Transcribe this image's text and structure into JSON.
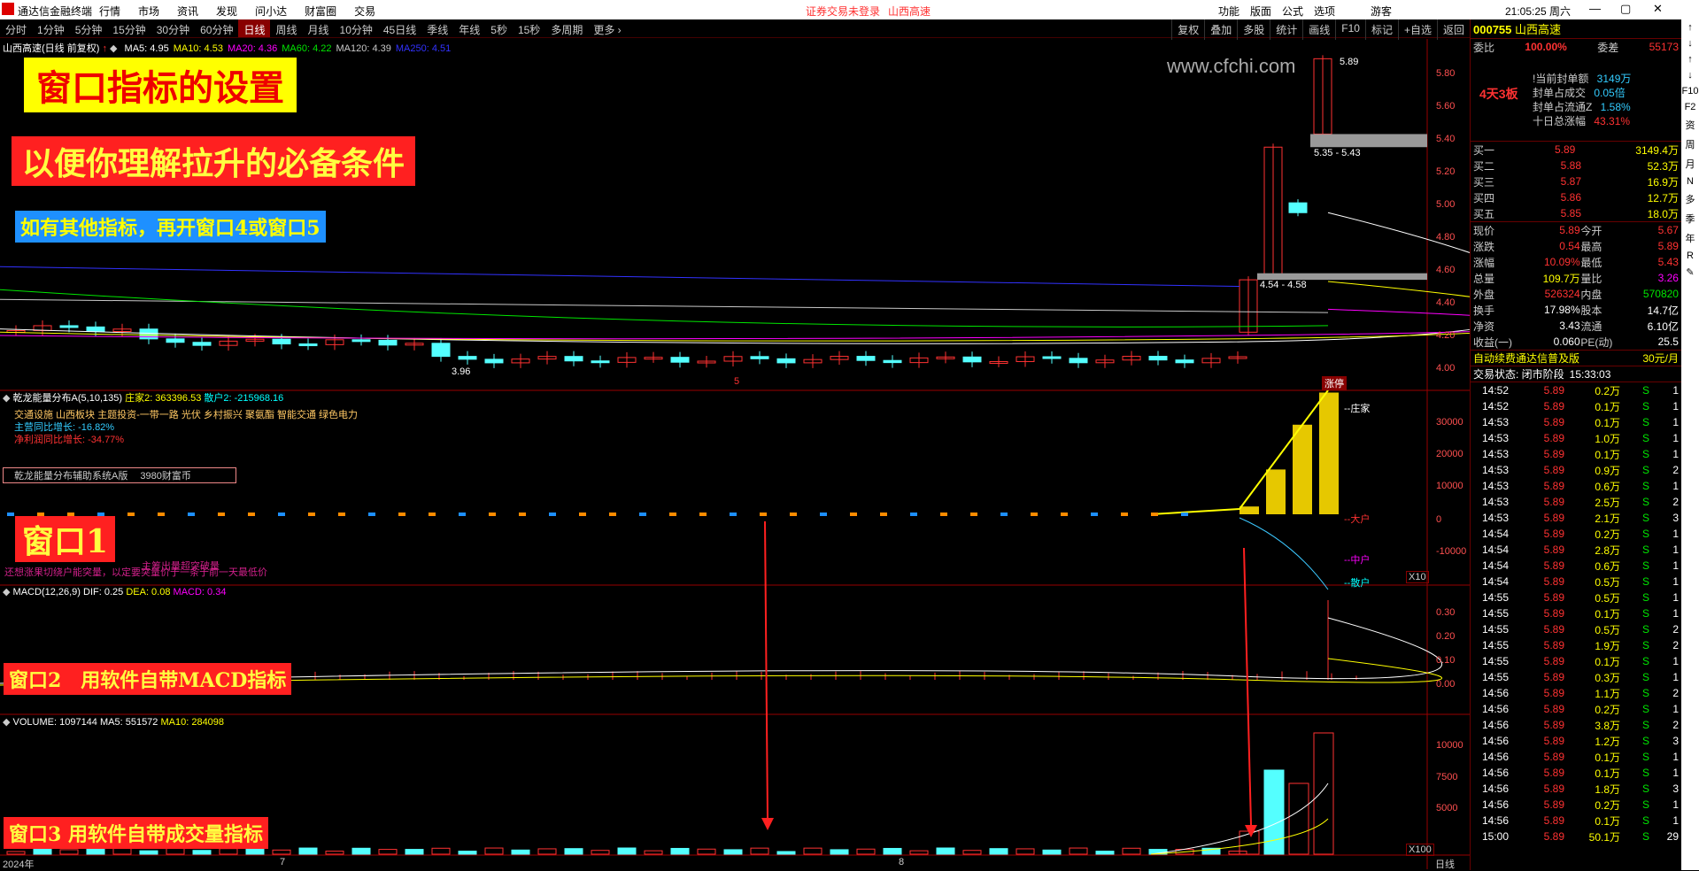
{
  "titlebar": {
    "app_name": "通达信金融终端",
    "menus": [
      "行情",
      "市场",
      "资讯",
      "发现",
      "问小达",
      "财富圈",
      "交易"
    ],
    "notice": "证券交易未登录",
    "notice_stock": "山西高速",
    "right_menus": [
      "功能",
      "版面",
      "公式",
      "选项"
    ],
    "user": "游客",
    "time": "21:05:25 周六"
  },
  "periods": [
    "分时",
    "1分钟",
    "5分钟",
    "15分钟",
    "30分钟",
    "60分钟",
    "日线",
    "周线",
    "月线",
    "10分钟",
    "45日线",
    "季线",
    "年线",
    "5秒",
    "15秒",
    "多周期",
    "更多 ›"
  ],
  "selected_period": "日线",
  "toolbar_right": [
    "复权",
    "叠加",
    "多股",
    "统计",
    "画线",
    "F10",
    "标记",
    "+自选",
    "返回"
  ],
  "main_chart": {
    "header_stock": "山西高速(日线 前复权)",
    "ma": [
      {
        "label": "MA5: 4.95",
        "color": "#ffffff"
      },
      {
        "label": "MA10: 4.53",
        "color": "#ffff00"
      },
      {
        "label": "MA20: 4.36",
        "color": "#ff00ff"
      },
      {
        "label": "MA60: 4.22",
        "color": "#00e600"
      },
      {
        "label": "MA120: 4.39",
        "color": "#c8c8c8"
      },
      {
        "label": "MA250: 4.51",
        "color": "#3232ff"
      }
    ],
    "watermark": "www.cfchi.com",
    "price_high_label": "5.89",
    "price_low_label": "3.96",
    "range1": "5.35 - 5.43",
    "range2": "4.54 - 4.58",
    "zhangting": "涨停",
    "axis_marker": "5"
  },
  "banners": {
    "title": "窗口指标的设置",
    "subtitle": "以便你理解拉升的必备条件",
    "note": "如有其他指标，再开窗口4或窗口5",
    "w1": "窗口1",
    "w2": "窗口2　用软件自带MACD指标",
    "w3": "窗口3 用软件自带成交量指标"
  },
  "win1": {
    "header": "乾龙能量分布A(5,10,135)",
    "zhuangjia": "庄家2: 363396.53",
    "sanhu": "散户2: -215968.16",
    "sectors": "交通设施 山西板块 主题投资-一带一路 光伏 乡村振兴 聚氨酯 智能交通 绿色电力",
    "zhuying": "主营同比增长: -16.82%",
    "jinglirun": "净利润同比增长: -34.77%",
    "box_text": "乾龙能量分布辅助系统A版　 3980财富币",
    "bottom_text": "还想涨果切绕户能突量，以定要突量价于一条于前一天最低价",
    "bottom_text2": "主筹出量超突破量",
    "legend_zhuang": "--庄家",
    "legend_da": "--大户",
    "legend_zhong": "--中户",
    "legend_san": "--散户",
    "x10": "X10",
    "axis": [
      "30000",
      "20000",
      "10000",
      "0",
      "-10000"
    ]
  },
  "win2": {
    "header": "MACD(12,26,9)",
    "dif": "DIF: 0.25",
    "dea": "DEA: 0.08",
    "macd": "MACD: 0.34",
    "axis": [
      "0.30",
      "0.20",
      "0.10",
      "0.00"
    ]
  },
  "win3": {
    "header": "VOLUME: 1097144",
    "ma5": "MA5: 551572",
    "ma10": "MA10: 284098",
    "x100": "X100",
    "axis": [
      "10000",
      "7500",
      "5000"
    ]
  },
  "price_axis": [
    "5.80",
    "5.60",
    "5.40",
    "5.20",
    "5.00",
    "4.80",
    "4.60",
    "4.40",
    "4.20",
    "4.00"
  ],
  "time_axis": {
    "y2024": "2024年",
    "m7": "7",
    "m8": "8",
    "period": "日线"
  },
  "quote": {
    "code": "000755",
    "name": "山西高速",
    "weibi_label": "委比",
    "weibi": "100.00%",
    "weicha_label": "委差",
    "weicha": "55173",
    "board_label": "4天3板",
    "seal_rows": [
      {
        "k": "!当前封单额",
        "v": "3149万"
      },
      {
        "k": "封单占成交",
        "v": "0.05倍"
      },
      {
        "k": "封单占流通Z",
        "v": "1.58%"
      },
      {
        "k": "十日总涨幅",
        "v": "43.31%"
      }
    ],
    "bids": [
      {
        "k": "买一",
        "p": "5.89",
        "v": "3149.4万"
      },
      {
        "k": "买二",
        "p": "5.88",
        "v": "52.3万"
      },
      {
        "k": "买三",
        "p": "5.87",
        "v": "16.9万"
      },
      {
        "k": "买四",
        "p": "5.86",
        "v": "12.7万"
      },
      {
        "k": "买五",
        "p": "5.85",
        "v": "18.0万"
      }
    ],
    "stats": [
      {
        "k1": "现价",
        "v1": "5.89",
        "k2": "今开",
        "v2": "5.67",
        "c1": "red",
        "c2": "red"
      },
      {
        "k1": "涨跌",
        "v1": "0.54",
        "k2": "最高",
        "v2": "5.89",
        "c1": "red",
        "c2": "red"
      },
      {
        "k1": "涨幅",
        "v1": "10.09%",
        "k2": "最低",
        "v2": "5.43",
        "c1": "red",
        "c2": "red"
      },
      {
        "k1": "总量",
        "v1": "109.7万",
        "k2": "量比",
        "v2": "3.26",
        "c1": "yellow",
        "c2": "mag"
      },
      {
        "k1": "外盘",
        "v1": "526324",
        "k2": "内盘",
        "v2": "570820",
        "c1": "red",
        "c2": "green"
      },
      {
        "k1": "换手",
        "v1": "17.98%",
        "k2": "股本",
        "v2": "14.7亿",
        "c1": "white",
        "c2": "white"
      },
      {
        "k1": "净资",
        "v1": "3.43",
        "k2": "流通",
        "v2": "6.10亿",
        "c1": "white",
        "c2": "white"
      },
      {
        "k1": "收益(一)",
        "v1": "0.060",
        "k2": "PE(动)",
        "v2": "25.5",
        "c1": "white",
        "c2": "white"
      }
    ],
    "ad_text": "自动续费通达信普及版",
    "ad_price": "30元/月",
    "trade_status": "交易状态: 闭市阶段",
    "trade_time": "15:33:03",
    "ticks": [
      {
        "t": "14:52",
        "p": "5.89",
        "v": "0.2万",
        "s": "S",
        "n": "1"
      },
      {
        "t": "14:52",
        "p": "5.89",
        "v": "0.1万",
        "s": "S",
        "n": "1"
      },
      {
        "t": "14:53",
        "p": "5.89",
        "v": "0.1万",
        "s": "S",
        "n": "1"
      },
      {
        "t": "14:53",
        "p": "5.89",
        "v": "1.0万",
        "s": "S",
        "n": "1"
      },
      {
        "t": "14:53",
        "p": "5.89",
        "v": "0.1万",
        "s": "S",
        "n": "1"
      },
      {
        "t": "14:53",
        "p": "5.89",
        "v": "0.9万",
        "s": "S",
        "n": "2"
      },
      {
        "t": "14:53",
        "p": "5.89",
        "v": "0.6万",
        "s": "S",
        "n": "1"
      },
      {
        "t": "14:53",
        "p": "5.89",
        "v": "2.5万",
        "s": "S",
        "n": "2"
      },
      {
        "t": "14:53",
        "p": "5.89",
        "v": "2.1万",
        "s": "S",
        "n": "3"
      },
      {
        "t": "14:54",
        "p": "5.89",
        "v": "0.2万",
        "s": "S",
        "n": "1"
      },
      {
        "t": "14:54",
        "p": "5.89",
        "v": "2.8万",
        "s": "S",
        "n": "1"
      },
      {
        "t": "14:54",
        "p": "5.89",
        "v": "0.6万",
        "s": "S",
        "n": "1"
      },
      {
        "t": "14:54",
        "p": "5.89",
        "v": "0.5万",
        "s": "S",
        "n": "1"
      },
      {
        "t": "14:55",
        "p": "5.89",
        "v": "0.5万",
        "s": "S",
        "n": "1"
      },
      {
        "t": "14:55",
        "p": "5.89",
        "v": "0.1万",
        "s": "S",
        "n": "1"
      },
      {
        "t": "14:55",
        "p": "5.89",
        "v": "0.5万",
        "s": "S",
        "n": "2"
      },
      {
        "t": "14:55",
        "p": "5.89",
        "v": "1.9万",
        "s": "S",
        "n": "2"
      },
      {
        "t": "14:55",
        "p": "5.89",
        "v": "0.1万",
        "s": "S",
        "n": "1"
      },
      {
        "t": "14:55",
        "p": "5.89",
        "v": "0.3万",
        "s": "S",
        "n": "1"
      },
      {
        "t": "14:56",
        "p": "5.89",
        "v": "1.1万",
        "s": "S",
        "n": "2"
      },
      {
        "t": "14:56",
        "p": "5.89",
        "v": "0.2万",
        "s": "S",
        "n": "1"
      },
      {
        "t": "14:56",
        "p": "5.89",
        "v": "3.8万",
        "s": "S",
        "n": "2"
      },
      {
        "t": "14:56",
        "p": "5.89",
        "v": "1.2万",
        "s": "S",
        "n": "3"
      },
      {
        "t": "14:56",
        "p": "5.89",
        "v": "0.1万",
        "s": "S",
        "n": "1"
      },
      {
        "t": "14:56",
        "p": "5.89",
        "v": "0.1万",
        "s": "S",
        "n": "1"
      },
      {
        "t": "14:56",
        "p": "5.89",
        "v": "1.8万",
        "s": "S",
        "n": "3"
      },
      {
        "t": "14:56",
        "p": "5.89",
        "v": "0.2万",
        "s": "S",
        "n": "1"
      },
      {
        "t": "14:56",
        "p": "5.89",
        "v": "0.1万",
        "s": "S",
        "n": "1"
      },
      {
        "t": "15:00",
        "p": "5.89",
        "v": "50.1万",
        "s": "S",
        "n": "29"
      }
    ]
  },
  "side_tools": [
    "↑",
    "↓",
    "↑",
    "↓",
    "F10",
    "F2",
    "资",
    "周",
    "月",
    "N",
    "多",
    "季",
    "年",
    "R",
    "✎"
  ]
}
